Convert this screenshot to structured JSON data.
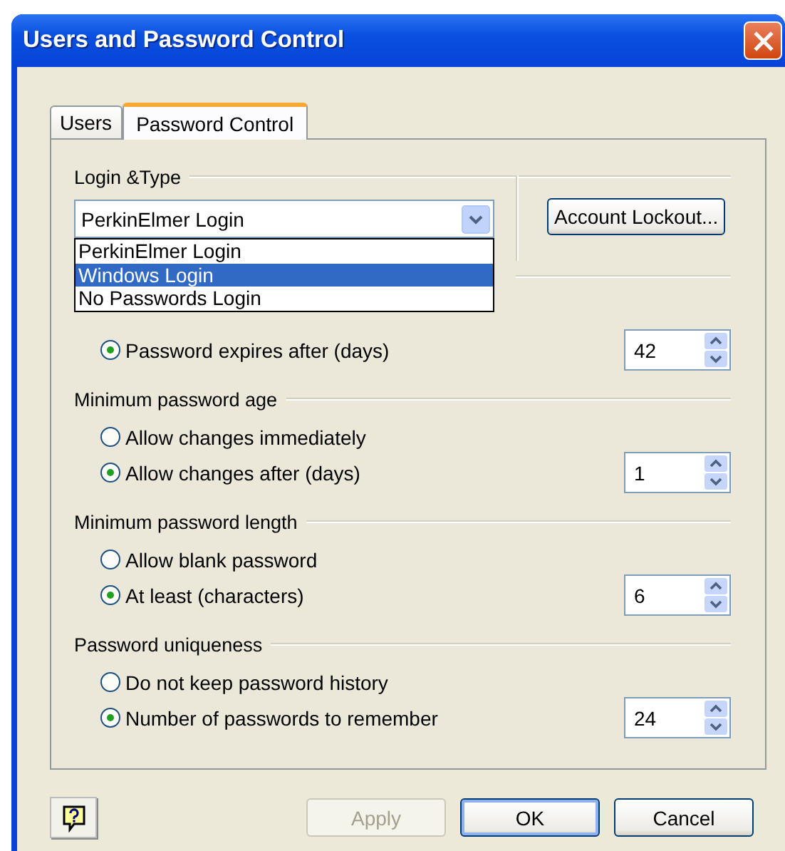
{
  "window": {
    "title": "Users and Password Control"
  },
  "tabs": [
    {
      "label": "Users",
      "selected": false
    },
    {
      "label": "Password Control",
      "selected": true
    }
  ],
  "login_type": {
    "title": "Login &Type",
    "combobox": {
      "value": "PerkinElmer Login",
      "expanded": true,
      "options": [
        {
          "label": "PerkinElmer Login",
          "highlighted": false
        },
        {
          "label": "Windows Login",
          "highlighted": true
        },
        {
          "label": "No Passwords Login",
          "highlighted": false
        }
      ]
    },
    "account_lockout_button": "Account Lockout..."
  },
  "sections": [
    {
      "options": [
        {
          "label": "Password expires after (days)",
          "selected": true
        }
      ],
      "spinner": "42"
    },
    {
      "title": "Minimum password age",
      "options": [
        {
          "label": "Allow changes immediately",
          "selected": false
        },
        {
          "label": "Allow changes after (days)",
          "selected": true
        }
      ],
      "spinner": "1"
    },
    {
      "title": "Minimum password length",
      "options": [
        {
          "label": "Allow blank password",
          "selected": false
        },
        {
          "label": "At least (characters)",
          "selected": true
        }
      ],
      "spinner": "6"
    },
    {
      "title": "Password uniqueness",
      "options": [
        {
          "label": "Do not keep password history",
          "selected": false
        },
        {
          "label": "Number of passwords to remember",
          "selected": true
        }
      ],
      "spinner": "24"
    }
  ],
  "buttons": [
    {
      "label": "Apply",
      "disabled": true,
      "default": false
    },
    {
      "label": "OK",
      "disabled": false,
      "default": true
    },
    {
      "label": "Cancel",
      "disabled": false,
      "default": false
    }
  ]
}
